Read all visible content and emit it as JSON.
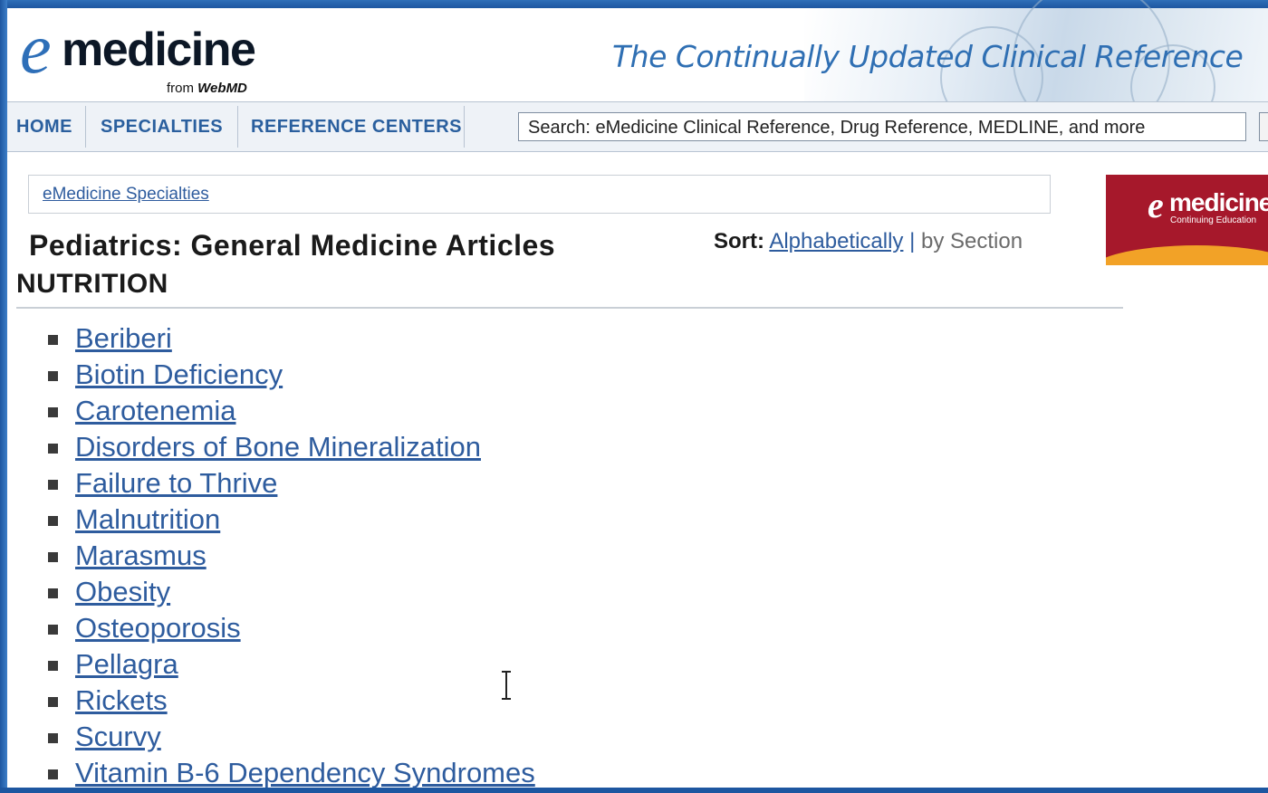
{
  "header": {
    "logo_e": "e",
    "logo_word": "medicine",
    "logo_from": "from",
    "logo_brand": "WebMD",
    "tagline": "The Continually Updated Clinical Reference"
  },
  "nav": {
    "items": [
      "HOME",
      "SPECIALTIES",
      "REFERENCE CENTERS"
    ],
    "search_placeholder": "Search: eMedicine Clinical Reference, Drug Reference, MEDLINE, and more"
  },
  "breadcrumb": {
    "link": "eMedicine Specialties"
  },
  "page": {
    "title": "Pediatrics: General Medicine Articles",
    "sort_label": "Sort:",
    "sort_alpha": "Alphabetically",
    "sort_sep": "|",
    "sort_section": "by Section",
    "section_heading": "NUTRITION"
  },
  "ad": {
    "e": "e",
    "word": "medicine",
    "sub": "Continuing Education"
  },
  "articles": [
    "Beriberi",
    "Biotin Deficiency",
    "Carotenemia",
    "Disorders of Bone Mineralization",
    "Failure to Thrive",
    "Malnutrition",
    "Marasmus",
    "Obesity",
    "Osteoporosis",
    "Pellagra",
    "Rickets",
    "Scurvy",
    "Vitamin B-6 Dependency Syndromes"
  ],
  "colors": {
    "frame": "#1d56a0",
    "link": "#2e5c9e",
    "nav_text": "#2a5f9e",
    "ad_red": "#a6182b",
    "ad_orange": "#f2a227"
  }
}
